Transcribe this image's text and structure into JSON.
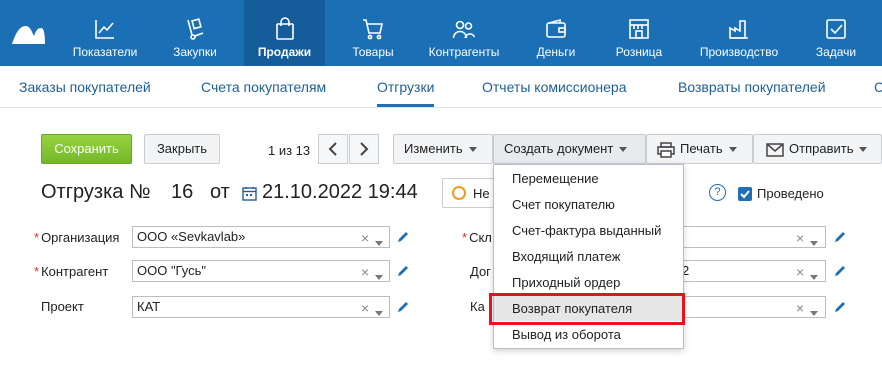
{
  "topnav": {
    "items": [
      {
        "label": "Показатели",
        "icon": "chart-line-icon"
      },
      {
        "label": "Закупки",
        "icon": "hand-truck-icon"
      },
      {
        "label": "Продажи",
        "icon": "shopping-bag-icon",
        "active": true
      },
      {
        "label": "Товары",
        "icon": "cart-icon"
      },
      {
        "label": "Контрагенты",
        "icon": "people-icon"
      },
      {
        "label": "Деньги",
        "icon": "wallet-icon"
      },
      {
        "label": "Розница",
        "icon": "store-icon"
      },
      {
        "label": "Производство",
        "icon": "factory-icon"
      },
      {
        "label": "Задачи",
        "icon": "checkbox-icon"
      }
    ]
  },
  "subnav": {
    "tabs": [
      "Заказы покупателей",
      "Счета покупателям",
      "Отгрузки",
      "Отчеты комиссионера",
      "Возвраты покупателей",
      "С"
    ],
    "active": "Отгрузки"
  },
  "toolbar": {
    "save_label": "Сохранить",
    "close_label": "Закрыть",
    "pager_text": "1 из 13",
    "change_label": "Изменить",
    "create_doc_label": "Создать документ",
    "print_label": "Печать",
    "send_label": "Отправить"
  },
  "document": {
    "title_prefix": "Отгрузка №",
    "number": "16",
    "date_prefix": "от",
    "datetime": "21.10.2022 19:44",
    "status_partial": "Не",
    "help_symbol": "?",
    "posted_label": "Проведено",
    "posted_checked": true
  },
  "form": {
    "organization_label": "Организация",
    "organization_value": "ООО «Sevkavlab»",
    "counterparty_label": "Контрагент",
    "counterparty_value": "ООО \"Гусь\"",
    "project_label": "Проект",
    "project_value": "КАТ",
    "warehouse_label_partial": "Скл",
    "contract_label_partial": "Дог",
    "contract_value_partial": "2",
    "channel_label_partial": "Ка",
    "clear_symbol": "×"
  },
  "create_doc_menu": {
    "items": [
      "Перемещение",
      "Счет покупателю",
      "Счет-фактура выданный",
      "Входящий платеж",
      "Приходный ордер",
      "Возврат покупателя",
      "Вывод из оборота"
    ],
    "highlighted": "Возврат покупателя"
  },
  "colors": {
    "nav_bg": "#1b6fb5",
    "nav_active_bg": "#145c9a",
    "save_green": "#85c634",
    "highlight_red": "#e2151b",
    "link_blue": "#1f5f99"
  }
}
